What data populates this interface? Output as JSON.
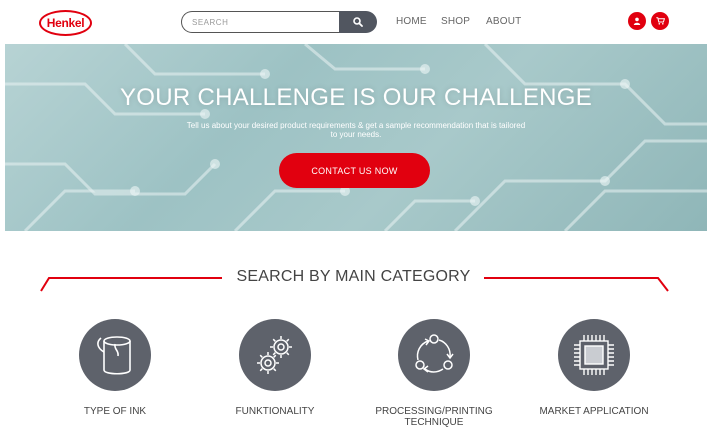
{
  "header": {
    "logo_text": "Henkel",
    "search_placeholder": "SEARCH",
    "nav": [
      "HOME",
      "SHOP",
      "ABOUT"
    ],
    "icons": [
      "search-icon",
      "user-icon",
      "cart-icon"
    ]
  },
  "hero": {
    "title": "YOUR CHALLENGE IS OUR CHALLENGE",
    "subtitle_line1": "Tell us about your desired product requirements & get a sample recommendation that is tailored",
    "subtitle_line2": "to your needs.",
    "cta_label": "CONTACT US NOW"
  },
  "categories": {
    "heading": "SEARCH BY MAIN CATEGORY",
    "items": [
      {
        "label_line1": "TYPE OF INK",
        "label_line2": "",
        "icon": "ink-bucket-icon"
      },
      {
        "label_line1": "FUNKTIONALITY",
        "label_line2": "",
        "icon": "gears-icon"
      },
      {
        "label_line1": "PROCESSING/PRINTING",
        "label_line2": "TECHNIQUE",
        "icon": "process-cycle-icon"
      },
      {
        "label_line1": "MARKET APPLICATION",
        "label_line2": "",
        "icon": "chip-icon"
      }
    ]
  },
  "colors": {
    "brand_red": "#e1000f",
    "icon_grey": "#5e626b"
  }
}
